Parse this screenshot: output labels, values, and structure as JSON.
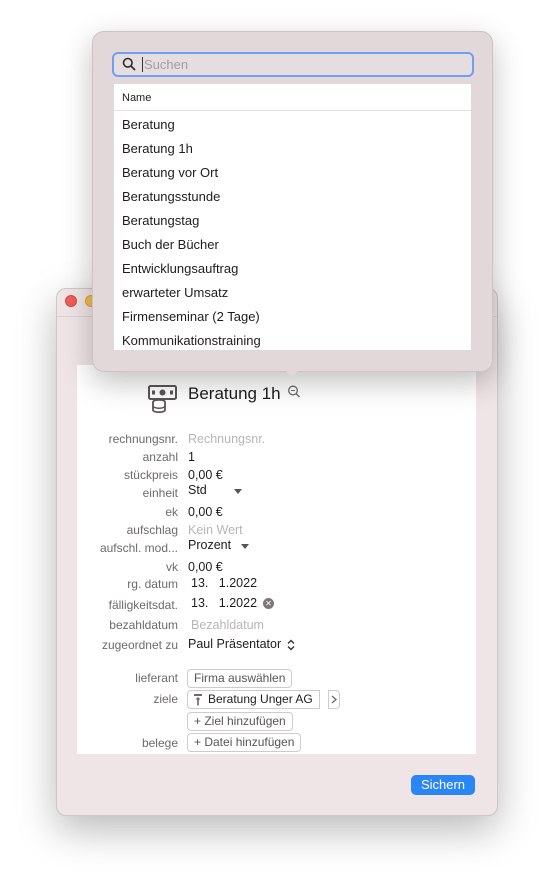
{
  "popover": {
    "search_placeholder": "Suchen",
    "column_header": "Name",
    "items": [
      "Beratung",
      "Beratung 1h",
      "Beratung vor Ort",
      "Beratungsstunde",
      "Beratungstag",
      "Buch der Bücher",
      "Entwicklungsauftrag",
      "erwarteter Umsatz",
      "Firmenseminar (2 Tage)",
      "Kommunikationstraining"
    ]
  },
  "header": {
    "title": "Beratung 1h"
  },
  "form": {
    "rechnungsnr": {
      "label": "rechnungsnr.",
      "placeholder": "Rechnungsnr."
    },
    "anzahl": {
      "label": "anzahl",
      "value": "1"
    },
    "stueckpreis": {
      "label": "stückpreis",
      "value": "0,00 €"
    },
    "einheit": {
      "label": "einheit",
      "value": "Std"
    },
    "ek": {
      "label": "ek",
      "value": "0,00 €"
    },
    "aufschlag": {
      "label": "aufschlag",
      "placeholder": "Kein Wert"
    },
    "aufschl_mod": {
      "label": "aufschl. mod...",
      "value": "Prozent"
    },
    "vk": {
      "label": "vk",
      "value": "0,00 €"
    },
    "rg_datum": {
      "label": "rg. datum",
      "value": "13.   1.2022"
    },
    "faelligkeitsdat": {
      "label": "fälligkeitsdat.",
      "value": "13.   1.2022"
    },
    "bezahldatum": {
      "label": "bezahldatum",
      "placeholder": "Bezahldatum"
    },
    "zugeordnet_zu": {
      "label": "zugeordnet zu",
      "value": "Paul Präsentator"
    },
    "lieferant": {
      "label": "lieferant",
      "button": "Firma auswählen"
    },
    "ziele": {
      "label": "ziele",
      "value": "Beratung Unger AG",
      "add_button": "+ Ziel hinzufügen"
    },
    "belege": {
      "label": "belege",
      "add_button": "+ Datei hinzufügen"
    }
  },
  "footer": {
    "save_label": "Sichern"
  },
  "colors": {
    "accent": "#2b86f5",
    "focus_ring": "#6f9ef4",
    "window_bg": "#efe4e6"
  },
  "icons": [
    "money-stack-icon",
    "search-icon",
    "clear-icon",
    "up-down-chevron-icon",
    "dropdown-caret-icon",
    "person-pin-icon",
    "chevron-right-icon"
  ]
}
